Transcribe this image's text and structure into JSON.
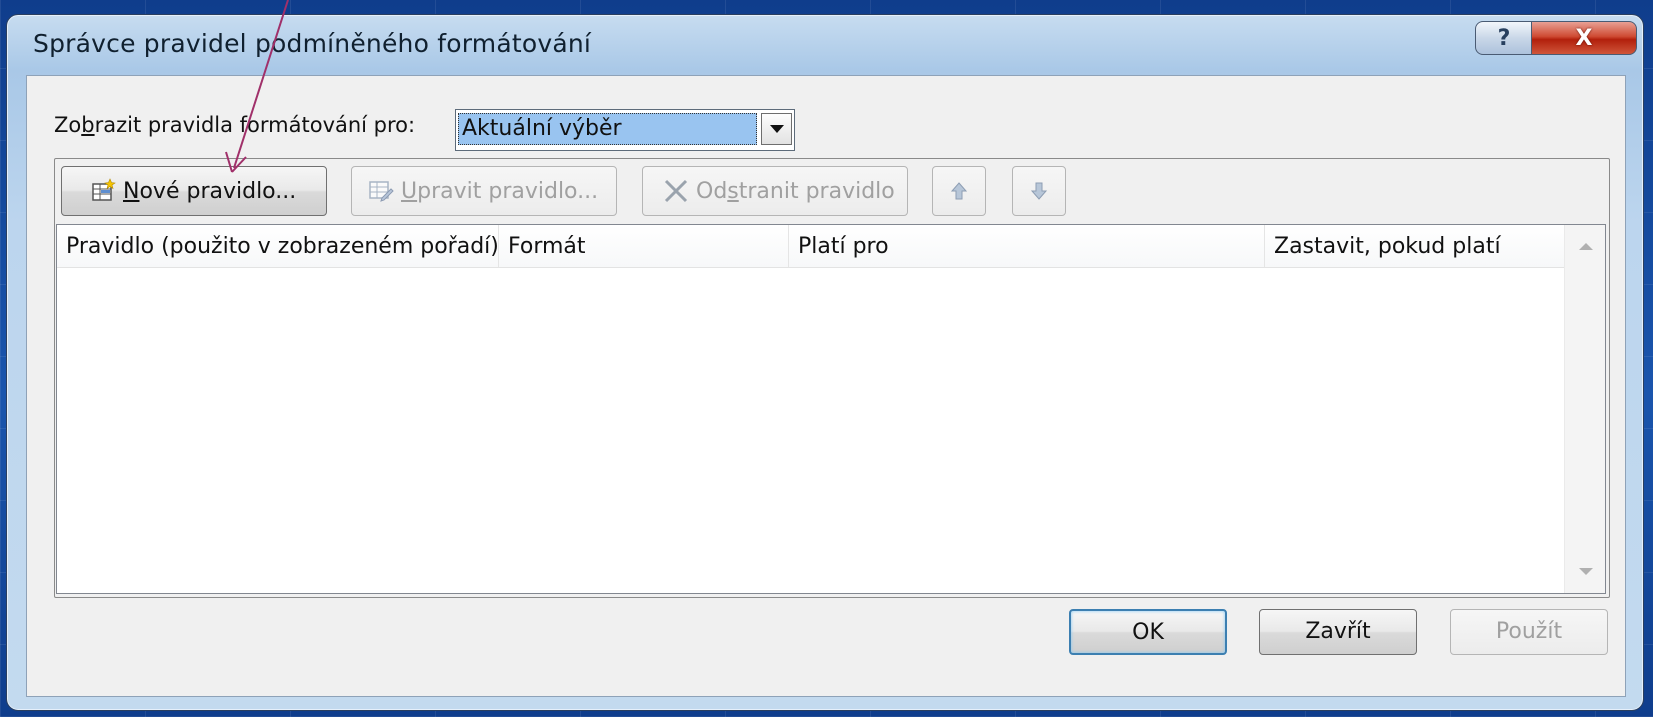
{
  "window": {
    "title": "Správce pravidel podmíněného formátování",
    "help_label": "?",
    "close_label": "X"
  },
  "scope": {
    "label_pre": "Zo",
    "label_accel": "b",
    "label_post": "razit pravidla formátování pro:",
    "selected": "Aktuální výběr"
  },
  "toolbar": {
    "new_rule": {
      "accel": "N",
      "rest": "ové pravidlo...",
      "enabled": true
    },
    "edit_rule": {
      "accel": "U",
      "rest": "pravit pravidlo...",
      "enabled": false
    },
    "delete_rule": {
      "pre": "Od",
      "accel": "s",
      "rest": "tranit pravidlo",
      "enabled": false
    },
    "move_up": {
      "icon": "arrow-up-icon"
    },
    "move_down": {
      "icon": "arrow-down-icon"
    }
  },
  "rules_table": {
    "columns": [
      "Pravidlo (použito v zobrazeném pořadí)",
      "Formát",
      "Platí pro",
      "Zastavit, pokud platí"
    ],
    "rows": []
  },
  "footer": {
    "ok_label": "OK",
    "close_label": "Zavřít",
    "apply_label": "Použít"
  },
  "colors": {
    "selection": "#99c4f0",
    "annotation_arrow": "#a0306a",
    "default_button_border": "#3c7fb1"
  }
}
